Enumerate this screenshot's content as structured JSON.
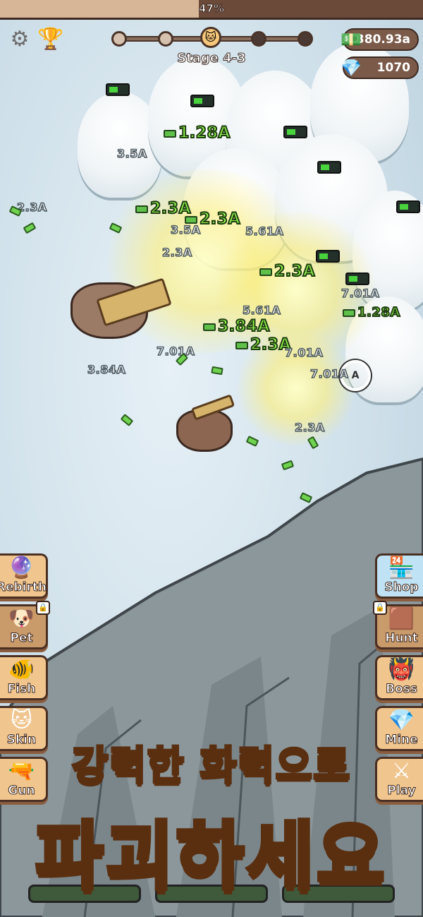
{
  "top_progress": {
    "label": "47%",
    "fraction": 0.47
  },
  "header": {
    "stage": "Stage 4-3",
    "cash": "380.93a",
    "gems": "1070"
  },
  "stage_track": {
    "nodes_total": 5,
    "current_node": 3
  },
  "floating_numbers": {
    "big": [
      "1.28A",
      "2.3A",
      "2.3A",
      "2.3A",
      "3.84A",
      "2.3A",
      "1.28A"
    ],
    "dim": [
      "3.5A",
      "2.3A",
      "3.5A",
      "5.61A",
      "7.01A",
      "7.01A",
      "7.01A",
      "3.84A",
      "2.3A",
      "5.61A",
      "7.01A",
      "2.3A"
    ]
  },
  "left_menu": [
    {
      "label": "Rebirth",
      "icon": "gem-icon",
      "locked": false
    },
    {
      "label": "Pet",
      "icon": "pet-icon",
      "locked": true
    },
    {
      "label": "Fish",
      "icon": "fish-icon",
      "locked": false
    },
    {
      "label": "Skin",
      "icon": "cat-skin-icon",
      "locked": false
    },
    {
      "label": "Gun",
      "icon": "gun-icon",
      "locked": false
    }
  ],
  "right_menu": [
    {
      "label": "Shop",
      "icon": "shop-icon",
      "locked": false
    },
    {
      "label": "Hunt",
      "icon": "hunt-icon",
      "locked": true
    },
    {
      "label": "Boss",
      "icon": "boss-icon",
      "locked": false
    },
    {
      "label": "Mine",
      "icon": "diamond-icon",
      "locked": false
    },
    {
      "label": "Play",
      "icon": "crossed-swords-icon",
      "locked": false
    }
  ],
  "promo": {
    "line1_a": "강력한 ",
    "line1_b": "화력",
    "line1_c": "으로",
    "line2": "파괴하세요"
  },
  "colors": {
    "accent_gold": "#ffcf4a",
    "money_green": "#8ef04a",
    "panel_brown": "#7b5a49"
  }
}
